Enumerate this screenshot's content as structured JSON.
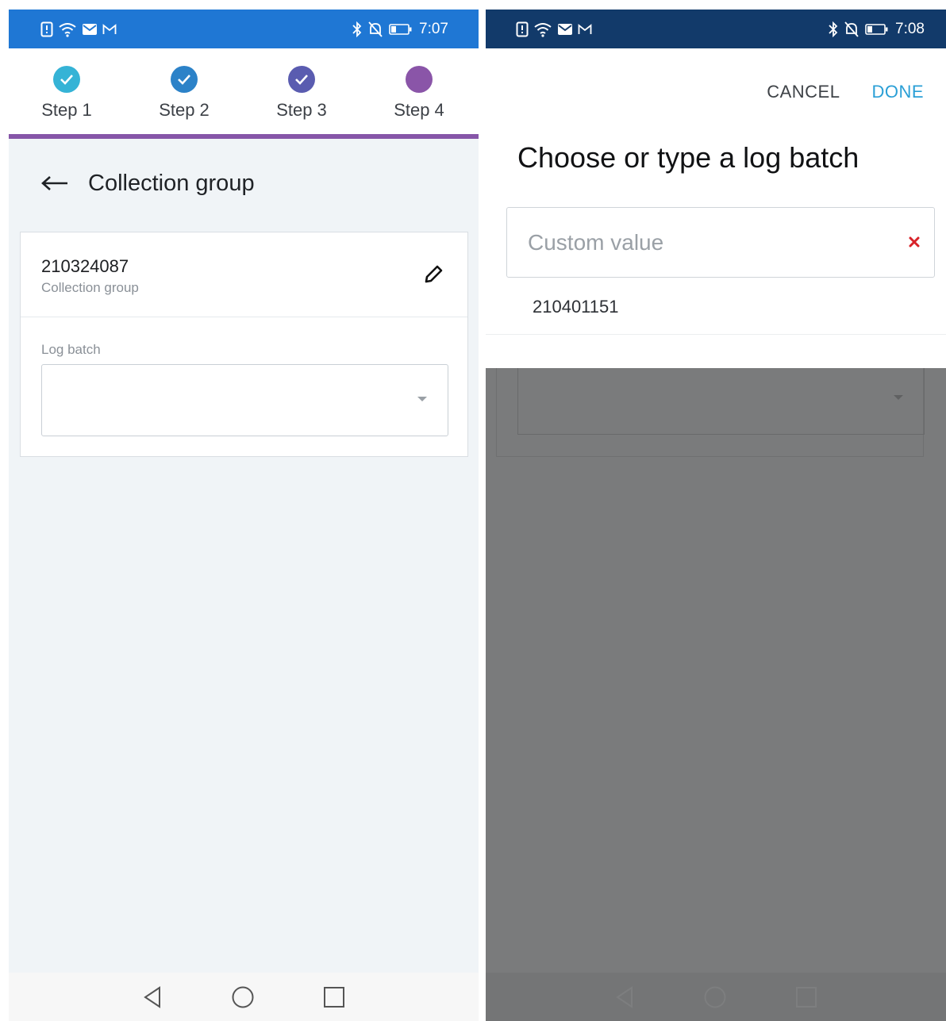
{
  "left_screen": {
    "status_time": "7:07",
    "steps": [
      {
        "label": "Step 1",
        "state": "completed",
        "color": "#35b3d6"
      },
      {
        "label": "Step 2",
        "state": "completed",
        "color": "#2c82c8"
      },
      {
        "label": "Step 3",
        "state": "completed",
        "color": "#5a5cb0"
      },
      {
        "label": "Step 4",
        "state": "current",
        "color": "#8a55a8"
      }
    ],
    "page_title": "Collection group",
    "collection_group": {
      "value": "210324087",
      "label": "Collection group"
    },
    "log_batch": {
      "label": "Log batch",
      "value": ""
    }
  },
  "right_screen": {
    "status_time": "7:08",
    "cancel_label": "CANCEL",
    "done_label": "DONE",
    "dialog_title": "Choose or type a log batch",
    "custom_input": {
      "placeholder": "Custom value",
      "value": ""
    },
    "options": [
      "210401151"
    ]
  },
  "colors": {
    "status_bar_left": "#1f77d4",
    "status_bar_right": "#123a6a",
    "stepper_line": "#8656a8",
    "done_accent": "#2a9fd6",
    "clear_icon": "#d8232a"
  }
}
